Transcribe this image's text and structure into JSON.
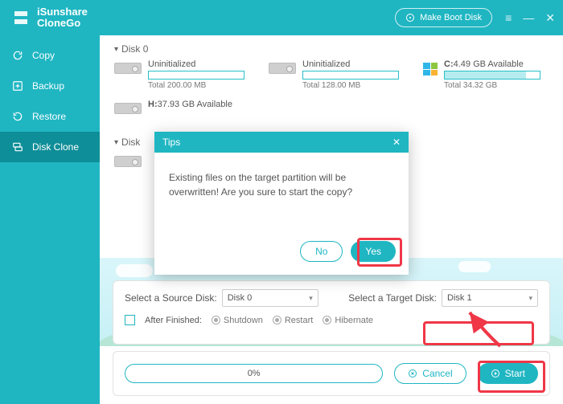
{
  "brand": {
    "l1": "iSunshare",
    "l2": "CloneGo"
  },
  "titlebar": {
    "makeBoot": "Make Boot Disk"
  },
  "sidebar": {
    "items": [
      {
        "label": "Copy"
      },
      {
        "label": "Backup"
      },
      {
        "label": "Restore"
      },
      {
        "label": "Disk Clone"
      }
    ]
  },
  "disks": {
    "d0": {
      "title": "Disk 0",
      "parts": [
        {
          "name": "Uninitialized",
          "total": "Total 200.00 MB",
          "fill": "0%"
        },
        {
          "name": "Uninitialized",
          "total": "Total 128.00 MB",
          "fill": "0%"
        },
        {
          "name": "C:",
          "avail": "4.49 GB Available",
          "total": "Total 34.32 GB",
          "fill": "86%",
          "os": true
        },
        {
          "name": "H:",
          "avail": "37.93 GB Available"
        }
      ]
    },
    "d1": {
      "title": "Disk"
    }
  },
  "modal": {
    "title": "Tips",
    "msg": "Existing files on the target partition will be overwritten! Are you sure to start the copy?",
    "no": "No",
    "yes": "Yes"
  },
  "select": {
    "srcLabel": "Select a Source Disk:",
    "srcValue": "Disk 0",
    "tgtLabel": "Select a Target Disk:",
    "tgtValue": "Disk 1",
    "afterLabel": "After Finished:",
    "opts": {
      "shutdown": "Shutdown",
      "restart": "Restart",
      "hibernate": "Hibernate"
    }
  },
  "footer": {
    "progress": "0%",
    "cancel": "Cancel",
    "start": "Start"
  }
}
